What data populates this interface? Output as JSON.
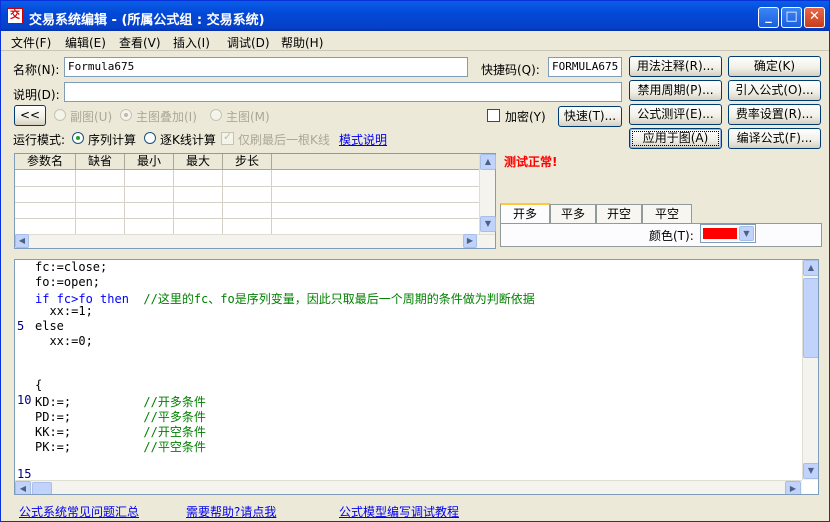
{
  "window": {
    "title": "交易系统编辑 - (所属公式组 : 交易系统)",
    "app_icon": "交",
    "controls": {
      "minimize": "_",
      "maximize": "□",
      "close": "✕"
    }
  },
  "menu": [
    "文件(F)",
    "编辑(E)",
    "查看(V)",
    "插入(I)",
    "调试(D)",
    "帮助(H)"
  ],
  "form": {
    "name_label": "名称(N):",
    "name_value": "Formula675",
    "shortcut_label": "快捷码(Q):",
    "shortcut_value": "FORMULA675",
    "desc_label": "说明(D):",
    "desc_value": "",
    "collapse_button": "<<",
    "view_options": [
      "副图(U)",
      "主图叠加(I)",
      "主图(M)"
    ],
    "encrypt_label": "加密(Y)",
    "quick_button": "快速(T)..."
  },
  "run_mode": {
    "label": "运行模式:",
    "sequential": "序列计算",
    "per_bar": "逐K线计算",
    "last_bar_only": "仅刷最后一根K线",
    "explain_link": "模式说明"
  },
  "right_buttons": [
    {
      "label": "用法注释(R)...",
      "name": "usage-notes-button"
    },
    {
      "label": "确定(K)",
      "name": "ok-button"
    },
    {
      "label": "禁用周期(P)...",
      "name": "disable-period-button"
    },
    {
      "label": "引入公式(O)...",
      "name": "import-formula-button"
    },
    {
      "label": "公式测评(E)...",
      "name": "formula-evaluate-button"
    },
    {
      "label": "费率设置(R)...",
      "name": "fee-settings-button"
    },
    {
      "label": "应用于图(A)",
      "name": "apply-to-chart-button"
    },
    {
      "label": "编译公式(F)...",
      "name": "compile-formula-button"
    }
  ],
  "param_table": {
    "headers": [
      "参数名",
      "缺省",
      "最小",
      "最大",
      "步长"
    ]
  },
  "status_text": "测试正常!",
  "tabs": [
    "开多",
    "平多",
    "开空",
    "平空"
  ],
  "color_label": "颜色(T):",
  "colors": {
    "swatch": "#ff0000",
    "status": "#ff0000"
  },
  "code": {
    "lines": [
      {
        "n": "",
        "text": "fc:=close;"
      },
      {
        "n": "",
        "text": "fo:=open;"
      },
      {
        "n": "",
        "kw": "if fc>fo then",
        "cm": "  //这里的fc、fo是序列变量，因此只取最后一个周期的条件做为判断依据"
      },
      {
        "n": "",
        "text": "  xx:=1;"
      },
      {
        "n": "5",
        "text": "else"
      },
      {
        "n": "",
        "text": "  xx:=0;"
      },
      {
        "n": "",
        "text": ""
      },
      {
        "n": "",
        "text": ""
      },
      {
        "n": "",
        "text": "{"
      },
      {
        "n": "10",
        "text": "KD:=;",
        "cm": "//开多条件"
      },
      {
        "n": "",
        "text": "PD:=;",
        "cm": "//平多条件"
      },
      {
        "n": "",
        "text": "KK:=;",
        "cm": "//开空条件"
      },
      {
        "n": "",
        "text": "PK:=;",
        "cm": "//平空条件"
      },
      {
        "n": "",
        "text": ""
      },
      {
        "n": "15",
        "text": ""
      }
    ]
  },
  "footer_links": [
    "公式系统常见问题汇总",
    "需要帮助?请点我",
    "公式模型编写调试教程"
  ]
}
